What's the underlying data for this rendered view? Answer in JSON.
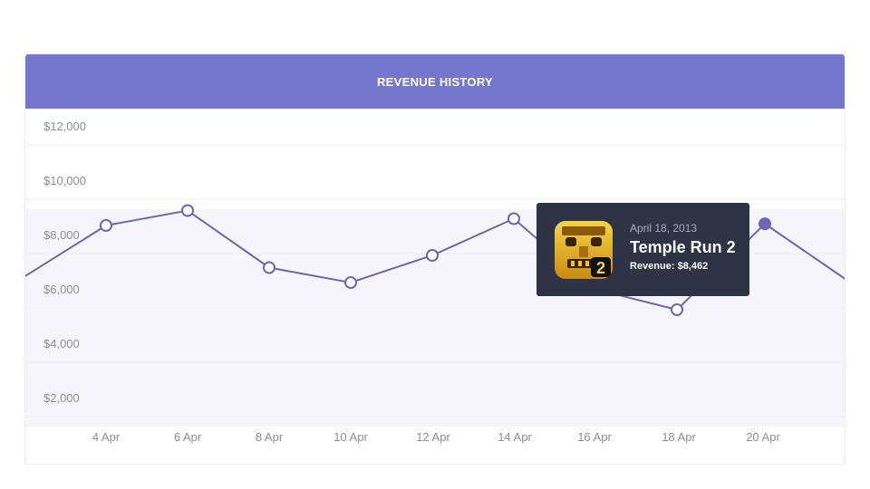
{
  "header": {
    "title": "REVENUE HISTORY"
  },
  "colors": {
    "accent": "#7577cf",
    "line": "#6b67b6",
    "area_fill": "#f6f5fb",
    "tooltip_bg": "#2e3446"
  },
  "chart_data": {
    "type": "line",
    "title": "REVENUE HISTORY",
    "xlabel": "",
    "ylabel": "",
    "y_ticks": [
      "$12,000",
      "$10,000",
      "$8,000",
      "$6,000",
      "$4,000",
      "$2,000"
    ],
    "y_tick_values": [
      12000,
      10000,
      8000,
      6000,
      4000,
      2000
    ],
    "ylim": [
      1000,
      13000
    ],
    "grid": true,
    "x_ticks": [
      "4 Apr",
      "6 Apr",
      "8 Apr",
      "10 Apr",
      "12 Apr",
      "14 Apr",
      "16 Apr",
      "18 Apr",
      "20 Apr"
    ],
    "series": [
      {
        "points": [
          {
            "x": "2 Apr",
            "y": 6500,
            "marker": false
          },
          {
            "x": "4 Apr",
            "y": 8400,
            "marker": true
          },
          {
            "x": "6 Apr",
            "y": 8950,
            "marker": true
          },
          {
            "x": "8 Apr",
            "y": 6850,
            "marker": true
          },
          {
            "x": "10 Apr",
            "y": 6300,
            "marker": true
          },
          {
            "x": "12 Apr",
            "y": 7300,
            "marker": true
          },
          {
            "x": "14 Apr",
            "y": 8650,
            "marker": true
          },
          {
            "x": "16 Apr",
            "y": 6050,
            "marker": true
          },
          {
            "x": "18 Apr",
            "y": 5300,
            "marker": true
          },
          {
            "x": "20 Apr",
            "y": 8462,
            "marker": true,
            "active": true
          },
          {
            "x": "22 Apr",
            "y": 6400,
            "marker": false
          }
        ]
      }
    ]
  },
  "tooltip": {
    "date": "April 18, 2013",
    "title": "Temple Run 2",
    "revenue": "Revenue: $8,462",
    "icon": "temple-run-2-app-icon"
  }
}
